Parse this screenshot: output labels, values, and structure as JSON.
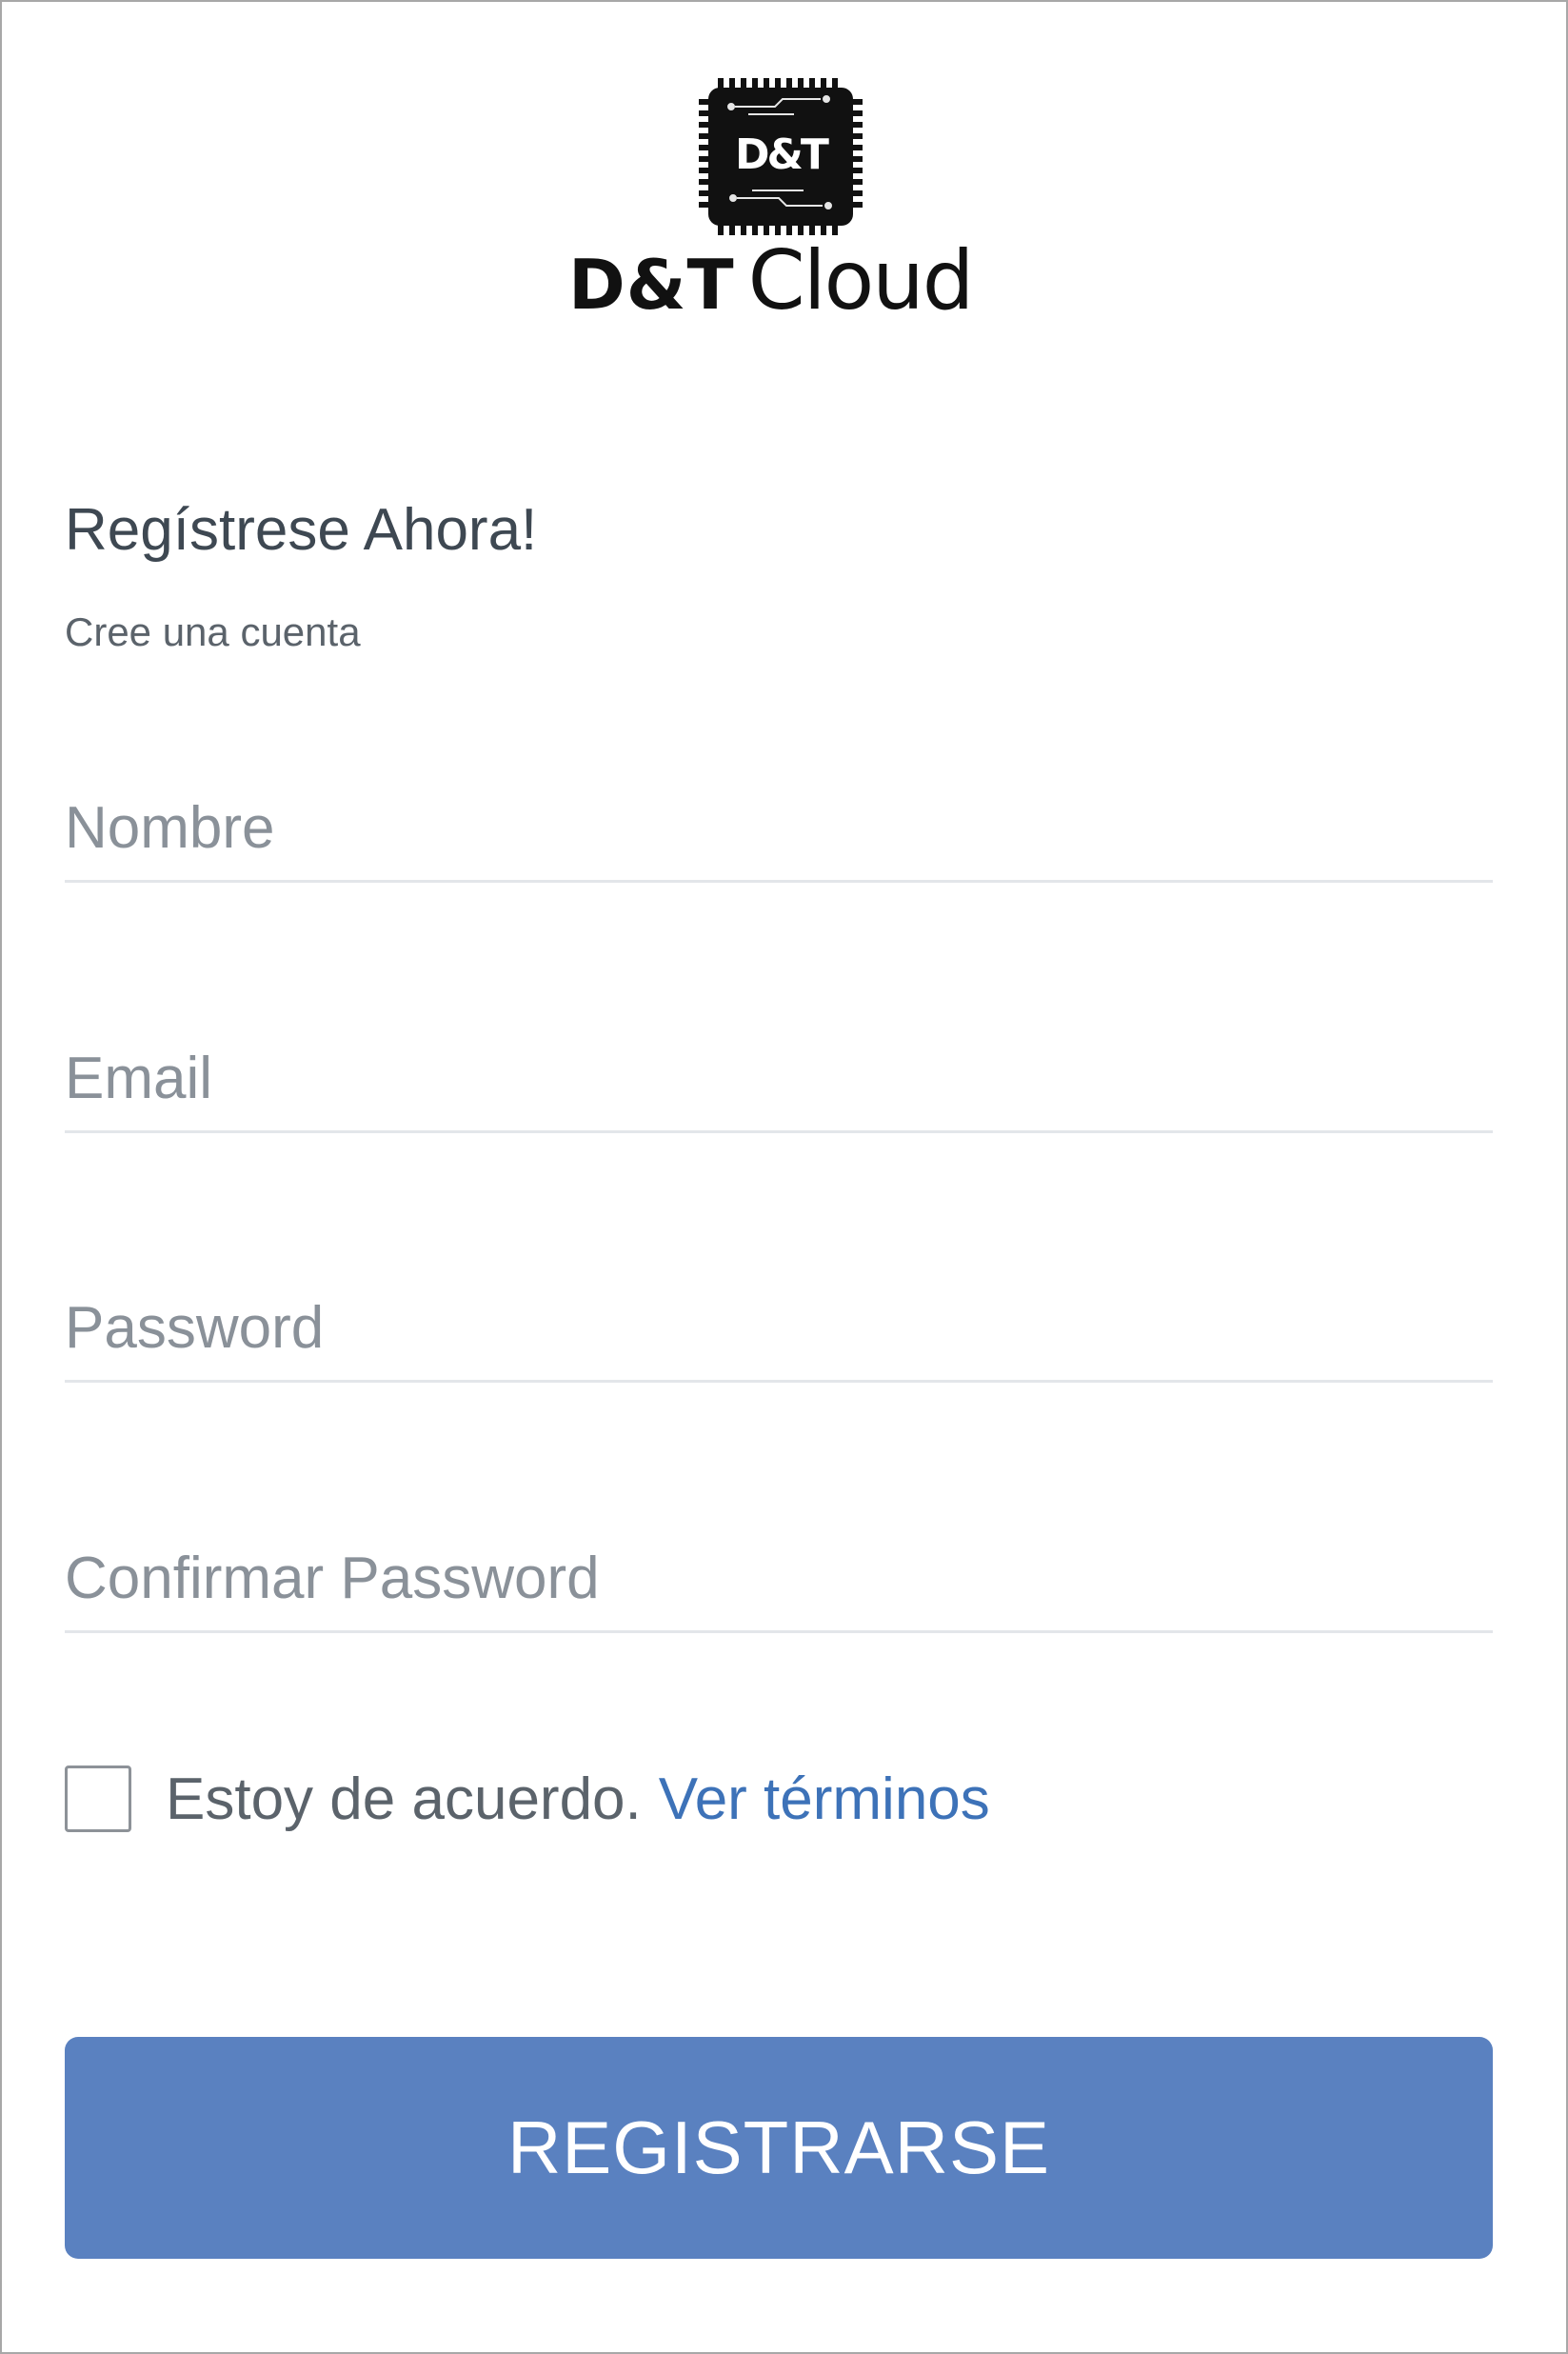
{
  "logo": {
    "chip_text": "D&T",
    "wordmark_strong": "D&T",
    "wordmark_light": "Cloud",
    "chip_color": "#111111"
  },
  "header": {
    "title": "Regístrese Ahora!",
    "subtitle": "Cree una cuenta"
  },
  "form": {
    "name_placeholder": "Nombre",
    "email_placeholder": "Email",
    "password_placeholder": "Password",
    "confirm_password_placeholder": "Confirmar Password",
    "name_value": "",
    "email_value": "",
    "password_value": "",
    "confirm_password_value": ""
  },
  "agree": {
    "checked": false,
    "label": "Estoy de acuerdo.",
    "terms_link": "Ver términos"
  },
  "submit": {
    "label": "REGISTRARSE"
  },
  "colors": {
    "button": "#5a81c0",
    "link": "#3d72b8",
    "title": "#3e4852",
    "placeholder": "#8a9199",
    "divider": "#e3e6ea"
  }
}
